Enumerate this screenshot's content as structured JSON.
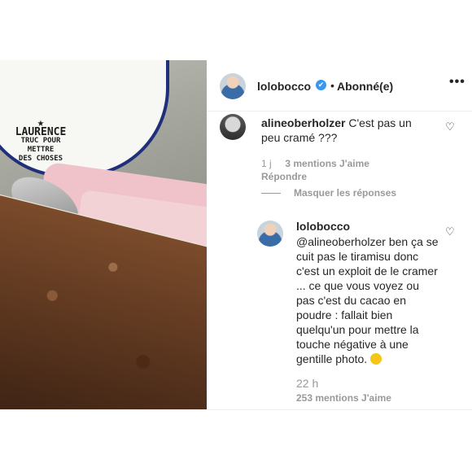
{
  "header": {
    "username": "lolobocco",
    "verified": "✔",
    "separator": "•",
    "follow_status": "Abonné(e)",
    "more": "•••"
  },
  "photo": {
    "bowl_text_lines": [
      "LAURENCE",
      "TRUC POUR",
      "METTRE",
      "DES CHOSES"
    ],
    "star": "★"
  },
  "comments": [
    {
      "username": "alineoberholzer",
      "text": "C'est pas un peu cramé ???",
      "time": "1 j",
      "likes": "3 mentions J'aime",
      "reply_label": "Répondre",
      "hide_replies": "Masquer les réponses"
    }
  ],
  "reply": {
    "username": "lolobocco",
    "text": "@alineoberholzer ben ça se cuit pas le tiramisu donc c'est un exploit de le cramer ... ce que vous voyez ou pas c'est du cacao en poudre : fallait bien quelqu'un pour mettre la touche négative à une gentille photo.",
    "time": "22 h",
    "likes": "253 mentions J'aime"
  },
  "icons": {
    "heart": "♡"
  },
  "colors": {
    "verified": "#3897f0",
    "muted": "#999999",
    "text": "#262626"
  }
}
